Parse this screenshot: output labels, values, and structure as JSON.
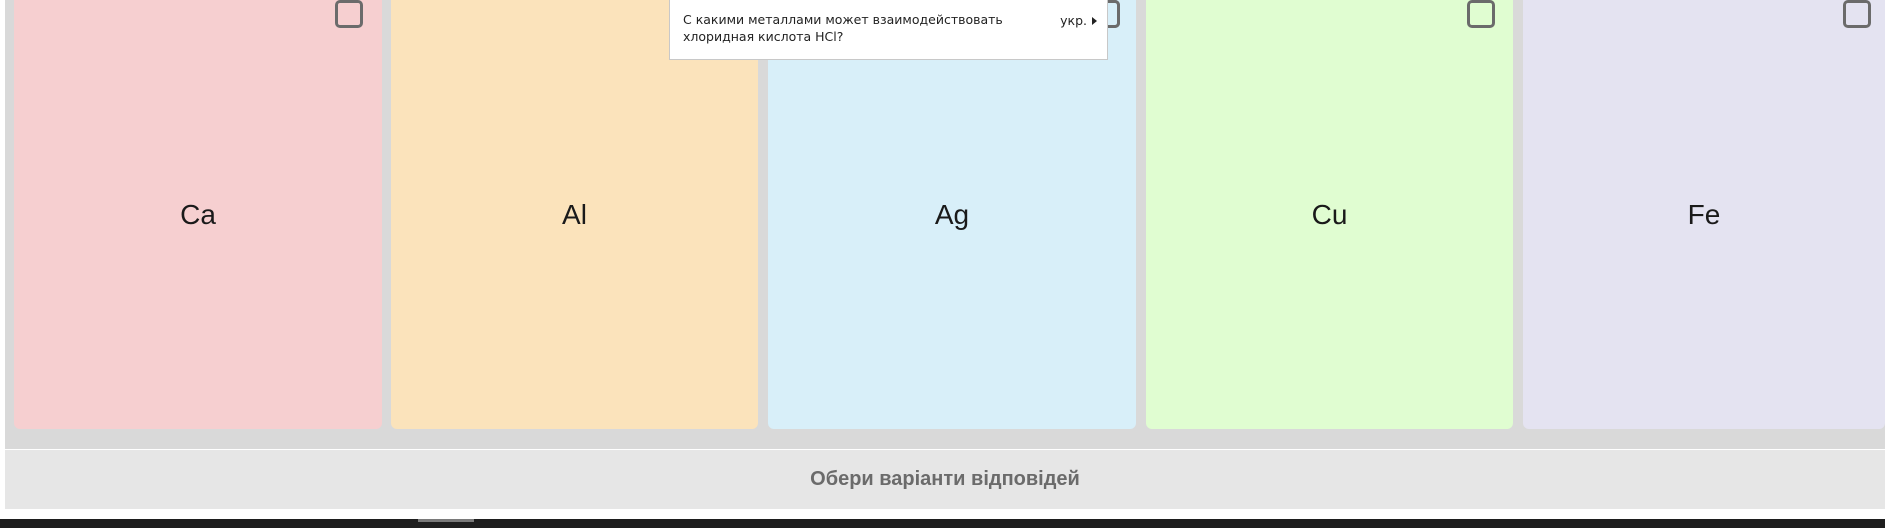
{
  "question": {
    "text": "С какими металлами может взаимодействовать хлоридная кислота HCl?",
    "language": "укр."
  },
  "cards": [
    {
      "label": "Ca",
      "color": "#f6cfd0"
    },
    {
      "label": "Al",
      "color": "#fbe3bb"
    },
    {
      "label": "Ag",
      "color": "#d8eff9"
    },
    {
      "label": "Cu",
      "color": "#e0fdd1"
    },
    {
      "label": "Fe",
      "color": "#e4e3f1"
    }
  ],
  "footer": {
    "prompt": "Обери варіанти відповідей"
  }
}
